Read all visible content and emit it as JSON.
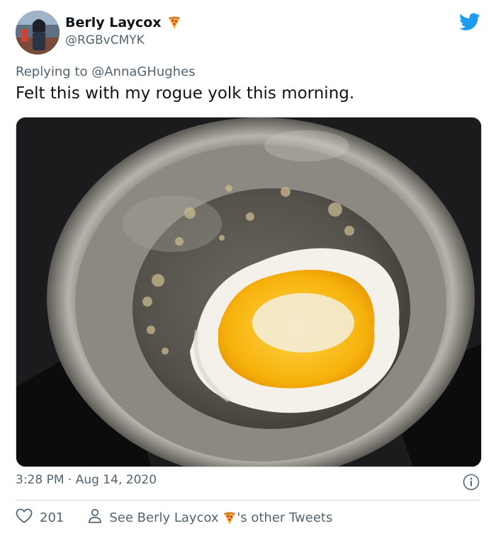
{
  "author": {
    "name": "Berly Laycox",
    "handle": "@RGBvCMYK",
    "emoji": "pizza-icon"
  },
  "tweet": {
    "reply_prefix": "Replying to",
    "reply_to": "@AnnaGHughes",
    "text": "Felt this with my rogue yolk this morning.",
    "timestamp": "3:28 PM · Aug 14, 2020",
    "photo_alt": "fried-egg-in-pan"
  },
  "actions": {
    "like_count": "201",
    "other_tweets_prefix": "See Berly Laycox",
    "other_tweets_suffix": "'s other Tweets"
  },
  "colors": {
    "brand": "#1d9bf0",
    "secondary_text": "#536471",
    "primary_text": "#0f1419",
    "divider": "#cfd9de"
  }
}
